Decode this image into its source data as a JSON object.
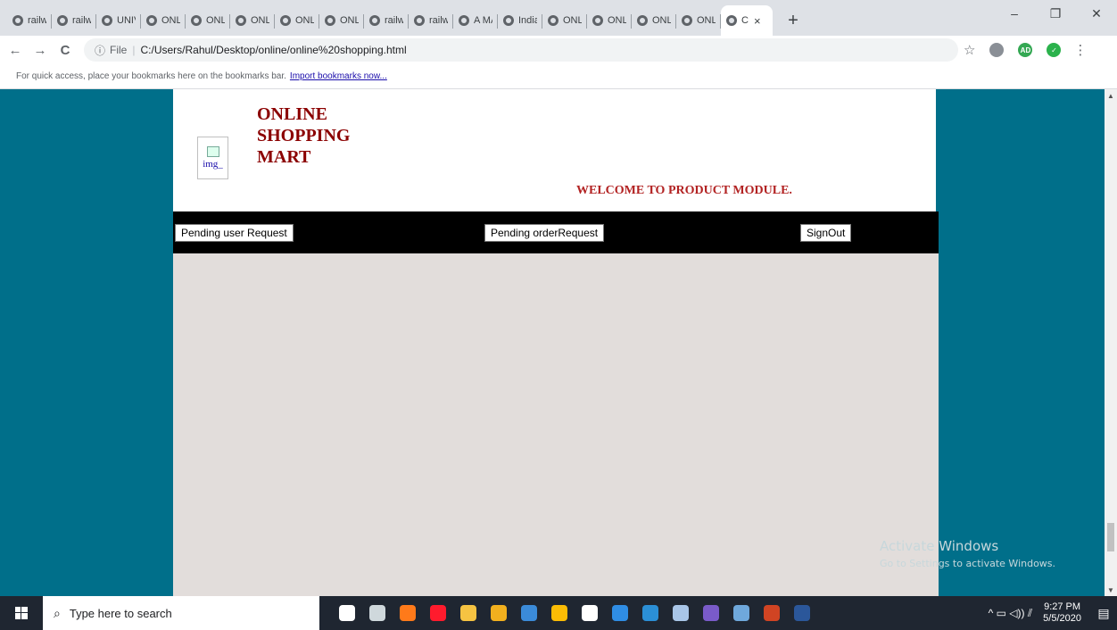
{
  "browser": {
    "tabs": [
      {
        "label": "railw"
      },
      {
        "label": "railw"
      },
      {
        "label": "UNIV"
      },
      {
        "label": "ONLI"
      },
      {
        "label": "ONLI"
      },
      {
        "label": "ONLI"
      },
      {
        "label": "ONLI"
      },
      {
        "label": "ONLI"
      },
      {
        "label": "railw"
      },
      {
        "label": "railw"
      },
      {
        "label": "A MA"
      },
      {
        "label": "India"
      },
      {
        "label": "ONLI"
      },
      {
        "label": "ONLI"
      },
      {
        "label": "ONLI"
      },
      {
        "label": "ONLI"
      }
    ],
    "active_tab": {
      "label": "C",
      "close": "×"
    },
    "new_tab": "+",
    "window_controls": {
      "minimize": "–",
      "maximize": "❐",
      "close": "✕"
    },
    "nav": {
      "back": "←",
      "forward": "→",
      "reload": "C"
    },
    "address": {
      "info_icon": "ⓘ",
      "scheme": "File",
      "separator": "|",
      "url": "C:/Users/Rahul/Desktop/online/online%20shopping.html"
    },
    "bookmarks_bar": {
      "text": "For quick access, place your bookmarks here on the bookmarks bar.",
      "link": "Import bookmarks now..."
    },
    "extensions": [
      {
        "icon": "adblock-icon",
        "color": "#8a8f96",
        "text": ""
      },
      {
        "icon": "profile-ad-icon",
        "color": "#34a853",
        "text": "AD"
      },
      {
        "icon": "shield-check-icon",
        "color": "#2bb24c",
        "text": "✓"
      }
    ]
  },
  "page": {
    "logo_alt": "img_",
    "brand_lines": [
      "ONLINE",
      "SHOPPING",
      "MART"
    ],
    "welcome": "WELCOME TO PRODUCT MODULE.",
    "nav_buttons": {
      "pending_user": "Pending user Request",
      "pending_order": "Pending orderRequest",
      "signout": "SignOut"
    },
    "colors": {
      "side_bg": "#006f8a",
      "content_bg": "#e2dddb",
      "brand": "#8b0000",
      "welcome": "#b22222",
      "navbar": "#000000"
    }
  },
  "watermark": {
    "line1": "Activate Windows",
    "line2": "Go to Settings to activate Windows."
  },
  "taskbar": {
    "search_placeholder": "Type here to search",
    "apps": [
      {
        "name": "cortana-icon",
        "color": "#ffffff"
      },
      {
        "name": "task-view-icon",
        "color": "#cfd8dc"
      },
      {
        "name": "firefox-icon",
        "color": "#ff7a1a"
      },
      {
        "name": "opera-icon",
        "color": "#ff1b2d"
      },
      {
        "name": "file-explorer-icon",
        "color": "#f6c342"
      },
      {
        "name": "store-icon",
        "color": "#f2b01e"
      },
      {
        "name": "app-icon",
        "color": "#3b8bd9"
      },
      {
        "name": "chrome-icon",
        "color": "#fbbc05"
      },
      {
        "name": "file-icon",
        "color": "#ffffff"
      },
      {
        "name": "mail-icon",
        "color": "#2f8de4"
      },
      {
        "name": "edge-icon",
        "color": "#2b8fd6"
      },
      {
        "name": "photos-icon",
        "color": "#a9c6e8"
      },
      {
        "name": "brave-icon",
        "color": "#7a5bc9"
      },
      {
        "name": "app2-icon",
        "color": "#6fa8dc"
      },
      {
        "name": "powerpoint-icon",
        "color": "#d04423"
      },
      {
        "name": "word-icon",
        "color": "#2b579a"
      }
    ],
    "tray_symbols": "^  ▭  ◁))  ⫽",
    "time": "9:27 PM",
    "date": "5/5/2020",
    "notifications_icon": "▤"
  },
  "scrollbar": {
    "position": 0.93,
    "visible_fraction": 0.06
  }
}
